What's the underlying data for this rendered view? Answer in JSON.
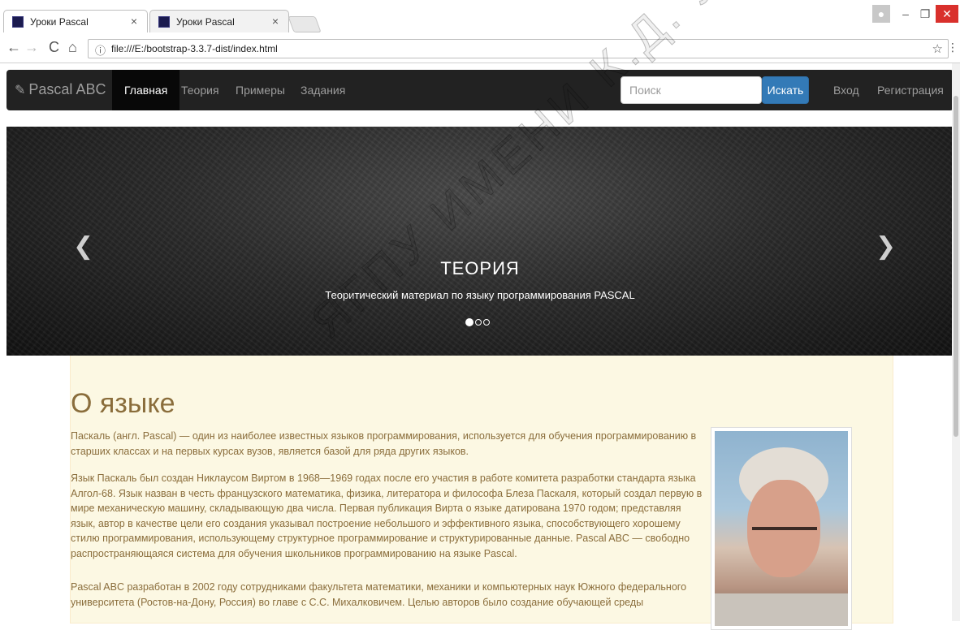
{
  "browser": {
    "tabs": [
      {
        "title": "Уроки Pascal",
        "close": "×"
      },
      {
        "title": "Уроки Pascal",
        "close": "×"
      }
    ],
    "url": "file:///E:/bootstrap-3.3.7-dist/index.html"
  },
  "navbar": {
    "brand": "Pascal ABC",
    "items": [
      "Главная",
      "Теория",
      "Примеры",
      "Задания"
    ],
    "search_placeholder": "Поиск",
    "search_button": "Искать",
    "login": "Вход",
    "register": "Регистрация"
  },
  "carousel": {
    "title": "ТЕОРИЯ",
    "caption": "Теоритический материал по языку программирования PASCAL",
    "slide_count": 3,
    "active_slide": 1
  },
  "content": {
    "heading": "О языке",
    "paragraphs": [
      "Паскаль (англ. Pascal) — один из наиболее известных языков программирования, используется для обучения программированию в старших классах и на первых курсах вузов, является базой для ряда других языков.",
      "Язык Паскаль был создан Никлаусом Виртом в 1968—1969 годах после его участия в работе комитета разработки стандарта языка Алгол-68. Язык назван в честь французского математика, физика, литератора и философа Блеза Паскаля, который создал первую в мире механическую машину, складывающую два числа. Первая публикация Вирта о языке датирована 1970 годом; представляя язык, автор в качестве цели его создания указывал построение небольшого и эффективного языка, способствующего хорошему стилю программирования, использующему структурное программирование и структурированные данные. Pascal ABC — свободно распространяющаяся система для обучения школьников программированию на языке Pascal.",
      "Pascal ABC разработан в 2002 году сотрудниками факультета математики, механики и компьютерных наук Южного федерального университета (Ростов-на-Дону, Россия) во главе с С.С. Михалковичем. Целью авторов было создание обучающей среды"
    ]
  },
  "watermark": "ЯГПУ ИМЕНИ К.Д. УШИНСКОГО"
}
